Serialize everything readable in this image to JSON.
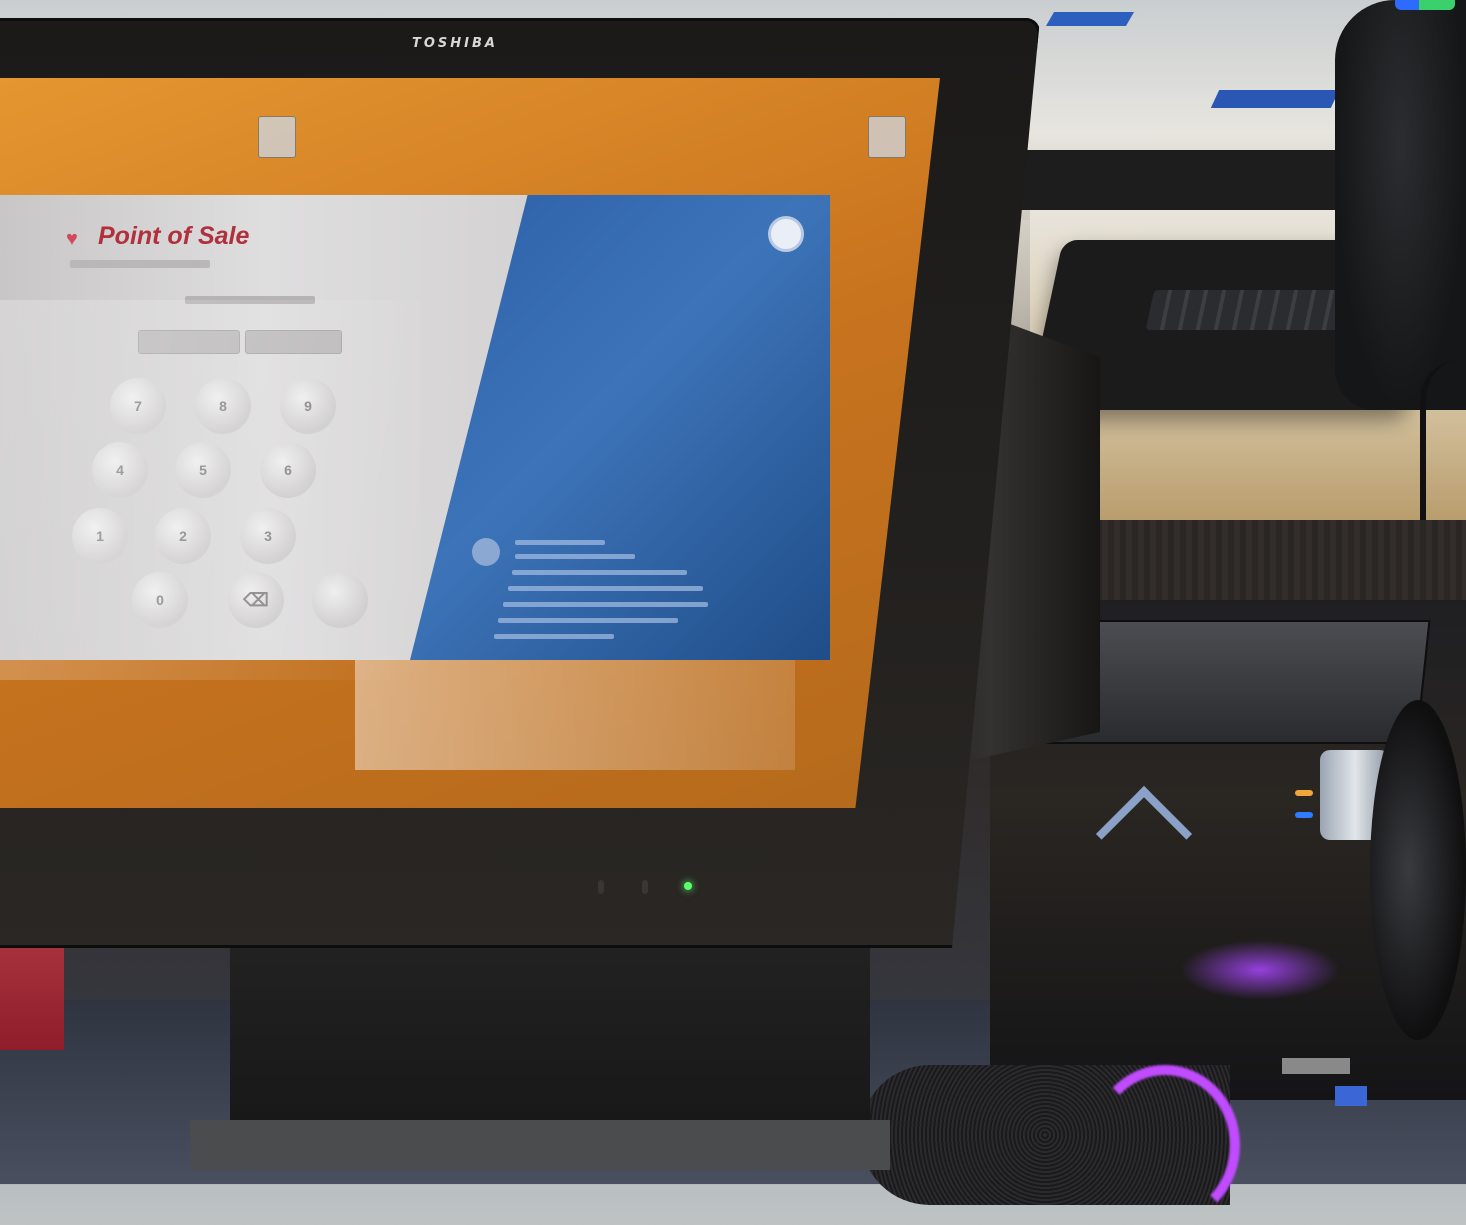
{
  "monitor": {
    "brand": "TOSHIBA"
  },
  "pos_app": {
    "title": "Point of Sale"
  },
  "keypad": {
    "keys": [
      "7",
      "8",
      "9",
      "4",
      "5",
      "6",
      "1",
      "2",
      "3",
      "0"
    ]
  },
  "icons": {
    "app_logo": "heart-logo-icon",
    "close": "close-icon",
    "backspace": "backspace-icon",
    "desktop_left": "desktop-shortcut-icon",
    "desktop_right": "desktop-shortcut-icon"
  },
  "colors": {
    "desktop_background": "#d4862a",
    "pos_title": "#b0303d",
    "pos_panel_blue": "#3066ad",
    "power_led": "#5bff6b",
    "speaker_ring": "#c04bff"
  }
}
